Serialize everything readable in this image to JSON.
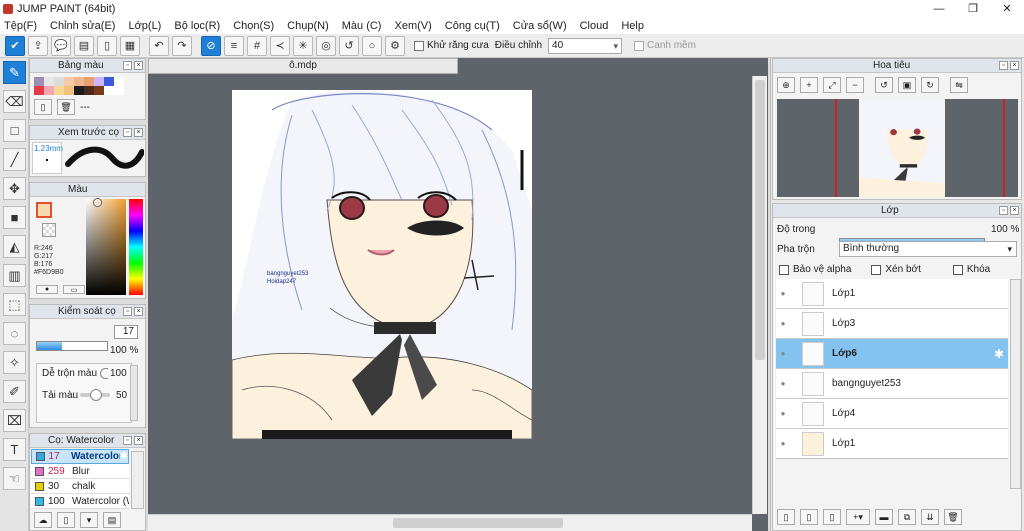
{
  "window": {
    "title": "JUMP PAINT (64bit)",
    "btn_min": "—",
    "btn_max": "❐",
    "btn_close": "✕"
  },
  "menu": [
    "Tệp(F)",
    "Chỉnh sửa(E)",
    "Lớp(L)",
    "Bộ lọc(R)",
    "Chọn(S)",
    "Chụp(N)",
    "Màu (C)",
    "Xem(V)",
    "Công cụ(T)",
    "Cửa sổ(W)",
    "Cloud",
    "Help"
  ],
  "toolbar": {
    "antialias_label": "Khử răng cưa",
    "adjust_label": "Điều chỉnh",
    "adjust_value": "40",
    "edge_label": "Canh mềm"
  },
  "panels": {
    "swatch_title": "Bảng màu",
    "swatch_set_label": "---",
    "brush_preview_title": "Xem trước cọ",
    "brush_size_text": "1.23mm",
    "color_title": "Màu",
    "rgb": {
      "r": "R:246",
      "g": "G:217",
      "b": "B:176",
      "hex": "#F6D9B0"
    },
    "brush_control_title": "Kiểm soát cọ",
    "brush_size_value": "17",
    "brush_opacity_value": "100 %",
    "blend_label": "Dễ trộn màu",
    "blend_value": "100",
    "amount_label": "Tải màu",
    "amount_value": "50",
    "brush_list_title": "Cọ: Watercolor",
    "brush_list": [
      {
        "size": "17",
        "name": "Watercolor",
        "color": "#3aa6e0"
      },
      {
        "size": "259",
        "name": "Blur",
        "color": "#e070c8"
      },
      {
        "size": "30",
        "name": "chalk",
        "color": "#e8d000"
      },
      {
        "size": "100",
        "name": "Watercolor (W",
        "color": "#30b8e8"
      }
    ]
  },
  "document": {
    "tab": "ô.mdp",
    "signature": [
      "bangnguyet253",
      "Hoidap247"
    ]
  },
  "navigator": {
    "title": "Hoa tiêu"
  },
  "layers_panel": {
    "title": "Lớp",
    "opacity_label": "Độ trong",
    "opacity_value": "100 %",
    "blend_label": "Pha trộn",
    "blend_value": "Bình thường",
    "protect_alpha": "Bảo vệ alpha",
    "clipping": "Xén bớt",
    "lock": "Khóa",
    "layers": [
      {
        "name": "Lớp1",
        "selected": false
      },
      {
        "name": "Lớp3",
        "selected": false
      },
      {
        "name": "Lớp6",
        "selected": true
      },
      {
        "name": "bangnguyet253",
        "selected": false
      },
      {
        "name": "Lớp4",
        "selected": false
      },
      {
        "name": "Lớp1",
        "selected": false
      }
    ]
  },
  "colors": {
    "accent": "#1e7fd6",
    "selected_layer": "#84c3f0",
    "canvas_bg": "#5f646b",
    "fg_color": "#F6D9B0"
  }
}
